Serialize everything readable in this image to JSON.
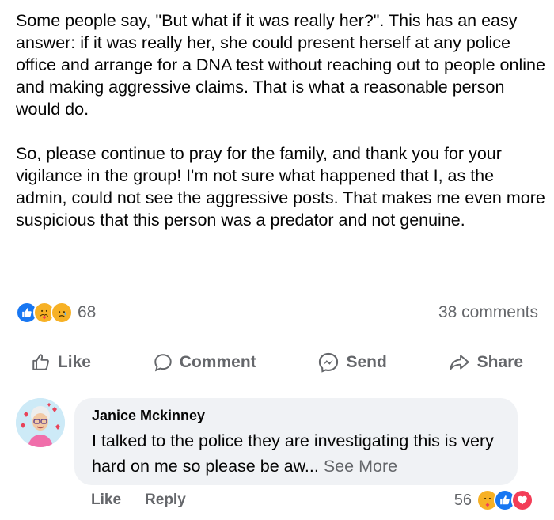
{
  "post": {
    "paragraphs": [
      "Some people say, \"But what if it was really her?\".  This has an easy answer: if it was really her, she could present herself at any police office and arrange for a DNA test without reaching out to people online and making aggressive claims. That is what a reasonable person would do.",
      "So, please continue to pray for the family, and thank you for your vigilance in the group! I'm not sure what happened that I, as the admin, could not see the aggressive posts. That makes me even more suspicious that this person was a predator and not genuine."
    ],
    "reaction_count": "68",
    "comments_count": "38 comments"
  },
  "actions": {
    "like": "Like",
    "comment": "Comment",
    "send": "Send",
    "share": "Share"
  },
  "comment": {
    "author": "Janice Mckinney",
    "text": "I talked to the police they are investigating this is very hard on me so please be aw...",
    "see_more": "See More",
    "like": "Like",
    "reply": "Reply",
    "reaction_count": "56"
  },
  "colors": {
    "like_blue": "#1877f2",
    "love_red": "#f33e58",
    "care_yellow": "#f7b125",
    "secondary_text": "#65676b"
  },
  "icons": [
    "thumbs-up-icon",
    "care-icon",
    "sad-icon",
    "love-icon",
    "comment-icon",
    "messenger-icon",
    "share-icon"
  ]
}
